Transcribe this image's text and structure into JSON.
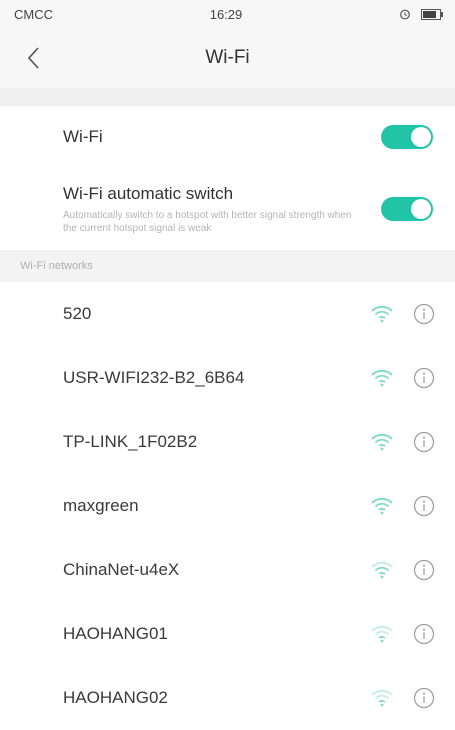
{
  "status": {
    "carrier": "CMCC",
    "time": "16:29"
  },
  "header": {
    "title": "Wi-Fi"
  },
  "settings": {
    "wifi_label": "Wi-Fi",
    "wifi_on": true,
    "auto_switch_label": "Wi-Fi automatic switch",
    "auto_switch_desc": "Automatically switch to a hotspot with better signal strength when the current hotspot signal is weak",
    "auto_switch_on": true
  },
  "networks_label": "Wi-Fi networks",
  "networks": [
    {
      "name": "520"
    },
    {
      "name": "USR-WIFI232-B2_6B64"
    },
    {
      "name": "TP-LINK_1F02B2"
    },
    {
      "name": "maxgreen"
    },
    {
      "name": "ChinaNet-u4eX"
    },
    {
      "name": "HAOHANG01"
    },
    {
      "name": "HAOHANG02"
    }
  ],
  "colors": {
    "accent": "#22c4a8",
    "wifi_icon": "#7fd9c6"
  }
}
